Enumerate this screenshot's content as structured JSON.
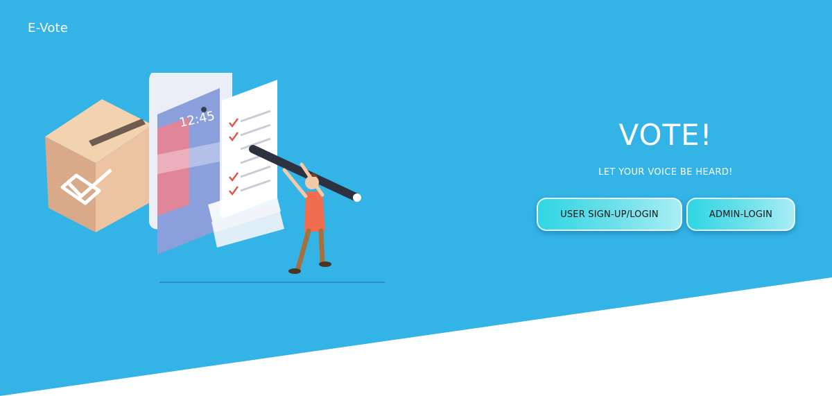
{
  "brand": {
    "name": "E-Vote"
  },
  "hero": {
    "title": "VOTE!",
    "subtitle": "LET YOUR VOICE BE HEARD!",
    "buttons": {
      "user_login": "USER SIGN-UP/LOGIN",
      "admin_login": "ADMIN-LOGIN"
    }
  },
  "illustration": {
    "phone_clock": "12:45"
  },
  "colors": {
    "hero_background": "#34b4e6",
    "footer_background": "#ffffff",
    "button_gradient_start": "#2fd6e4",
    "button_gradient_end": "#a9eef4",
    "text_light": "#ffffff",
    "text_dark": "#111111"
  }
}
